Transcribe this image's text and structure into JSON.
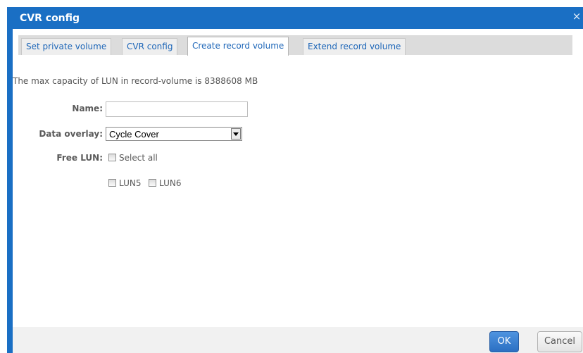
{
  "dialog": {
    "title": "CVR config",
    "close_label": "×"
  },
  "tabs": [
    {
      "label": "Set private volume",
      "active": false
    },
    {
      "label": "CVR config",
      "active": false
    },
    {
      "label": "Create record volume",
      "active": true
    },
    {
      "label": "Extend record volume",
      "active": false
    }
  ],
  "info_text": "The max capacity of LUN in record-volume is 8388608 MB",
  "form": {
    "name_label": "Name:",
    "name_value": "",
    "overlay_label": "Data overlay:",
    "overlay_value": "Cycle Cover",
    "free_lun_label": "Free LUN:",
    "select_all_label": "Select all",
    "luns": [
      {
        "label": "LUN5",
        "checked": false
      },
      {
        "label": "LUN6",
        "checked": false
      }
    ]
  },
  "buttons": {
    "ok": "OK",
    "cancel": "Cancel"
  },
  "colors": {
    "titlebar": "#1a6fc4",
    "tab_text": "#1d66b8",
    "ok_button": "#2b6fc2"
  }
}
